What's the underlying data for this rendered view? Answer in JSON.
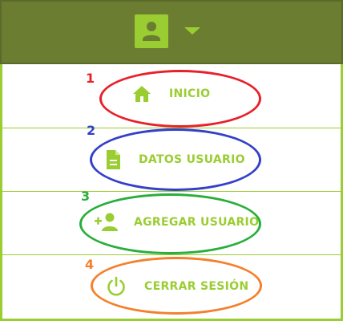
{
  "header": {
    "user_icon": "account-box-icon",
    "dropdown_icon": "caret-down-icon"
  },
  "menu": {
    "items": [
      {
        "label": "INICIO",
        "icon": "home-icon",
        "annotation": "1",
        "annotation_color": "#e8202a"
      },
      {
        "label": "DATOS USUARIO",
        "icon": "document-icon",
        "annotation": "2",
        "annotation_color": "#3340c8"
      },
      {
        "label": "AGREGAR USUARIO",
        "icon": "add-user-icon",
        "annotation": "3",
        "annotation_color": "#2aae3a"
      },
      {
        "label": "CERRAR SESIÓN",
        "icon": "power-icon",
        "annotation": "4",
        "annotation_color": "#f57f2a"
      }
    ]
  },
  "colors": {
    "header_bg": "#6b7d31",
    "accent": "#9acd32"
  }
}
